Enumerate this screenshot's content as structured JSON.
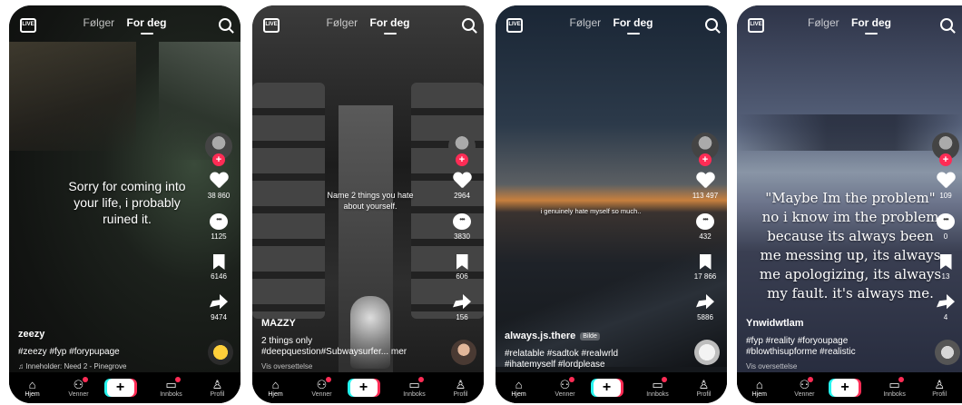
{
  "screens": [
    {
      "live_label": "LIVE",
      "tabs": [
        "Følger",
        "For deg"
      ],
      "overlay_text": "Sorry for coming into your life, i probably ruined it.",
      "counts": {
        "likes": "38 860",
        "comments": "1125",
        "saves": "6146",
        "shares": "9474"
      },
      "username": "zeezy",
      "hashtags": "#zeezy #fyp #forypupage",
      "sound": "♫ Inneholder: Need 2 - Pinegrove",
      "translate": ""
    },
    {
      "live_label": "LIVE",
      "tabs": [
        "Følger",
        "For deg"
      ],
      "overlay_text": "Name 2 things you hate about yourself.",
      "counts": {
        "likes": "2964",
        "comments": "3830",
        "saves": "606",
        "shares": "156"
      },
      "username": "MAZZY",
      "hashtags": "2 things only #deepquestion#Subwaysurfer... mer",
      "sound": "",
      "translate": "Vis oversettelse"
    },
    {
      "live_label": "LIVE",
      "tabs": [
        "Følger",
        "For deg"
      ],
      "overlay_text": "i genuinely hate myself so much..",
      "counts": {
        "likes": "113 497",
        "comments": "432",
        "saves": "17 866",
        "shares": "5886"
      },
      "username": "always.js.there",
      "badge": "Bilde",
      "hashtags": "#relatable #sadtok #realwrld #ihatemyself #lordplease",
      "sound": "",
      "translate": ""
    },
    {
      "live_label": "LIVE",
      "tabs": [
        "Følger",
        "For deg"
      ],
      "overlay_text": "\"Maybe Im the problem\" no i know im the problem because its always been me messing up, its always me apologizing, its always my fault. it's always me.",
      "counts": {
        "likes": "109",
        "comments": "0",
        "saves": "13",
        "shares": "4"
      },
      "username": "Ynwidwtlam",
      "hashtags": "#fyp #reality #foryoupage #blowthisupforme #realistic",
      "sound": "",
      "translate": "Vis oversettelse"
    }
  ],
  "nav": [
    "Hjem",
    "Venner",
    "",
    "Innboks",
    "Profil"
  ],
  "colors": {
    "accent": "#fe2c55",
    "cyan": "#25f4ee",
    "nav_bg": "#000000"
  }
}
